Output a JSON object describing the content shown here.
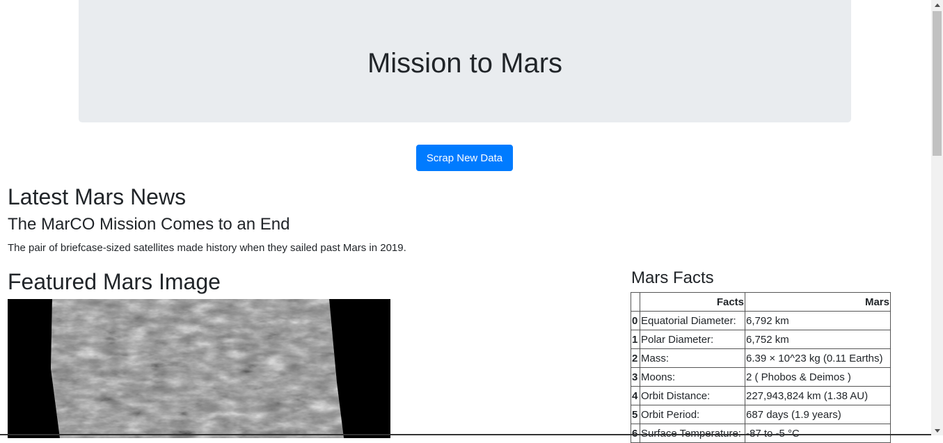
{
  "header": {
    "title": "Mission to Mars"
  },
  "actions": {
    "scrape_label": "Scrap New Data"
  },
  "news": {
    "section_heading": "Latest Mars News",
    "title": "The MarCO Mission Comes to an End",
    "paragraph": "The pair of briefcase-sized satellites made history when they sailed past Mars in 2019."
  },
  "featured": {
    "heading": "Featured Mars Image"
  },
  "facts": {
    "heading": "Mars Facts",
    "columns": [
      "",
      "Facts",
      "Mars"
    ],
    "rows": [
      {
        "index": "0",
        "fact": "Equatorial Diameter:",
        "value": "6,792 km"
      },
      {
        "index": "1",
        "fact": "Polar Diameter:",
        "value": "6,752 km"
      },
      {
        "index": "2",
        "fact": "Mass:",
        "value": "6.39 × 10^23 kg (0.11 Earths)"
      },
      {
        "index": "3",
        "fact": "Moons:",
        "value": "2 ( Phobos & Deimos )"
      },
      {
        "index": "4",
        "fact": "Orbit Distance:",
        "value": "227,943,824 km (1.38 AU)"
      },
      {
        "index": "5",
        "fact": "Orbit Period:",
        "value": "687 days (1.9 years)"
      },
      {
        "index": "6",
        "fact": "Surface Temperature:",
        "value": "-87 to -5 °C"
      }
    ]
  },
  "colors": {
    "primary": "#007bff",
    "jumbotron_bg": "#e9ecef",
    "text": "#212529"
  }
}
